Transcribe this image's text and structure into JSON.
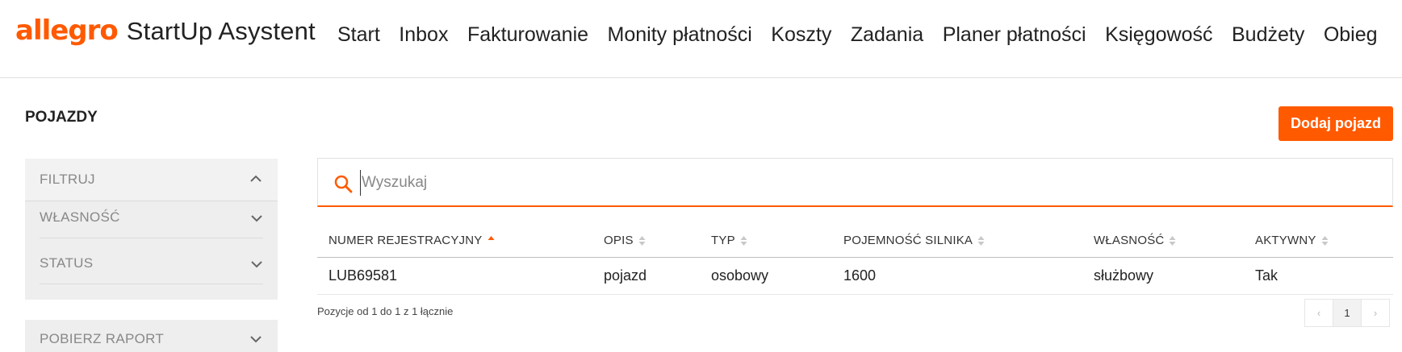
{
  "header": {
    "logo": "allegro",
    "app_name": "StartUp Asystent",
    "nav": [
      "Start",
      "Inbox",
      "Fakturowanie",
      "Monity płatności",
      "Koszty",
      "Zadania",
      "Planer płatności",
      "Księgowość",
      "Budżety",
      "Obieg"
    ]
  },
  "page": {
    "title": "POJAZDY",
    "add_button": "Dodaj pojazd"
  },
  "sidebar": {
    "filter_title": "FILTRUJ",
    "filters": [
      "WŁASNOŚĆ",
      "STATUS"
    ],
    "report_title": "POBIERZ RAPORT"
  },
  "search": {
    "placeholder": "Wyszukaj",
    "value": ""
  },
  "table": {
    "columns": [
      "NUMER REJESTRACYJNY",
      "OPIS",
      "TYP",
      "POJEMNOŚĆ SILNIKA",
      "WŁASNOŚĆ",
      "AKTYWNY"
    ],
    "sorted_column": "NUMER REJESTRACYJNY",
    "rows": [
      [
        "LUB69581",
        "pojazd",
        "osobowy",
        "1600",
        "służbowy",
        "Tak"
      ]
    ]
  },
  "pagination": {
    "summary": "Pozycje od 1 do 1 z 1 łącznie",
    "prev": "‹",
    "current_page": "1",
    "next": "›"
  },
  "colors": {
    "accent": "#ff5a00"
  }
}
